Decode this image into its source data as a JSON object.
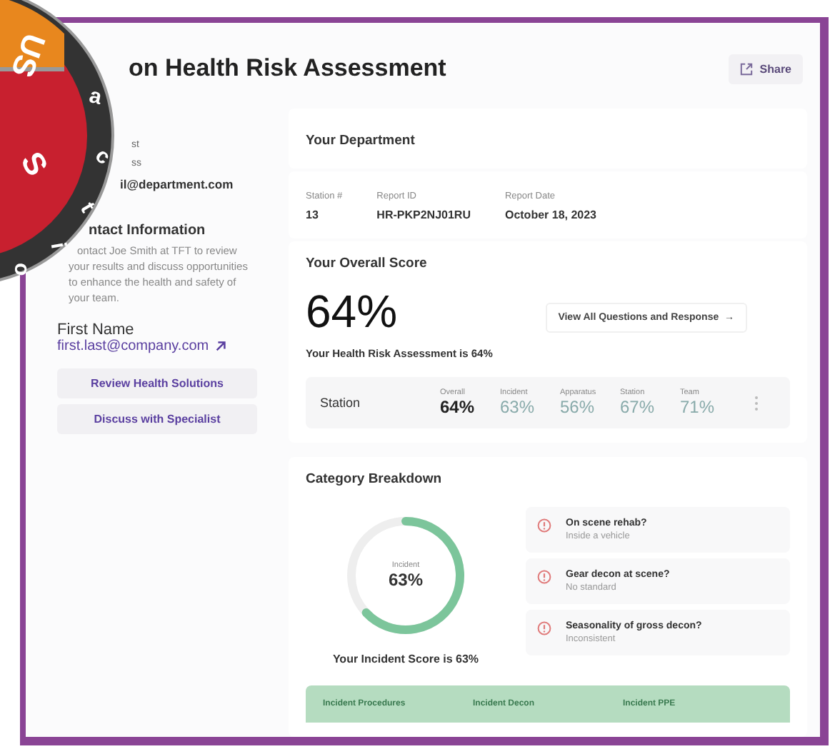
{
  "badge": {
    "top_text": "US",
    "middle_text": "S",
    "ring_letters": [
      "a",
      "c",
      "t",
      "i",
      "o"
    ]
  },
  "header": {
    "title": "on Health Risk Assessment",
    "share_label": "Share"
  },
  "profile": {
    "label_1": "st",
    "label_2": "ss",
    "email": "il@department.com"
  },
  "contact": {
    "title": "ntact Information",
    "text": "ontact Joe Smith at TFT to review your results and discuss opportunities to enhance the health and safety of your team.",
    "name": "First Name",
    "link": "first.last@company.com"
  },
  "actions": [
    "Review Health Solutions",
    "Discuss with Specialist"
  ],
  "department": {
    "title": "Your Department",
    "fields": [
      {
        "label": "Station #",
        "value": "13"
      },
      {
        "label": "Report ID",
        "value": "HR-PKP2NJ01RU"
      },
      {
        "label": "Report Date",
        "value": "October 18, 2023"
      }
    ]
  },
  "score": {
    "title": "Your Overall Score",
    "value": "64%",
    "view_all": "View All Questions and Response",
    "arrow": "→",
    "summary": "Your Health Risk Assessment is 64%",
    "row_label": "Station",
    "columns": [
      {
        "label": "Overall",
        "value": "64%",
        "primary": true
      },
      {
        "label": "Incident",
        "value": "63%",
        "primary": false
      },
      {
        "label": "Apparatus",
        "value": "56%",
        "primary": false
      },
      {
        "label": "Station",
        "value": "67%",
        "primary": false
      },
      {
        "label": "Team",
        "value": "71%",
        "primary": false
      }
    ]
  },
  "breakdown": {
    "title": "Category Breakdown",
    "gauge_label": "Incident",
    "gauge_value": "63%",
    "caption": "Your Incident Score is 63%",
    "alerts": [
      {
        "question": "On scene rehab?",
        "answer": "Inside a vehicle"
      },
      {
        "question": "Gear decon at scene?",
        "answer": "No standard"
      },
      {
        "question": "Seasonality of gross decon?",
        "answer": "Inconsistent"
      }
    ],
    "table_columns": [
      "Incident Procedures",
      "Incident Decon",
      "Incident PPE"
    ]
  }
}
